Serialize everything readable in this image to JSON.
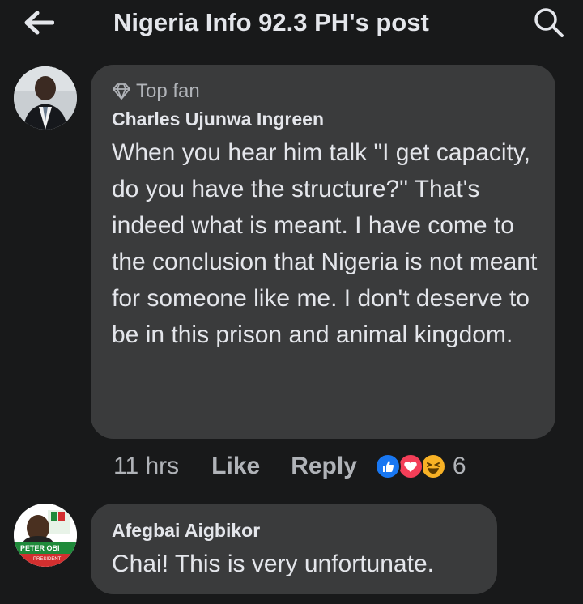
{
  "header": {
    "title": "Nigeria Info 92.3 PH's post",
    "back_icon": "arrow-left-icon",
    "search_icon": "search-icon"
  },
  "comments": [
    {
      "badge": "Top fan",
      "badge_icon": "diamond-icon",
      "author": "Charles Ujunwa Ingreen",
      "text": "When you hear him talk \"I get capacity, do you have the structure?\" That's indeed what is meant. I have come to the conclusion that Nigeria is not meant for someone like me. I don't deserve to be in this prison and animal kingdom.",
      "time": "11 hrs",
      "like_label": "Like",
      "reply_label": "Reply",
      "reactions": [
        "like",
        "love",
        "haha"
      ],
      "reaction_count": "6"
    },
    {
      "author": "Afegbai Aigbikor",
      "text": "Chai! This is very unfortunate.",
      "avatar_text": "PETER OBI",
      "avatar_subtext": "PRESIDENT"
    }
  ],
  "colors": {
    "background": "#18191a",
    "bubble": "#3a3b3c",
    "primary_text": "#e4e6eb",
    "secondary_text": "#b0b3b8",
    "like_blue": "#1877f2",
    "love_red": "#f33e58",
    "haha_yellow": "#f7b125"
  }
}
